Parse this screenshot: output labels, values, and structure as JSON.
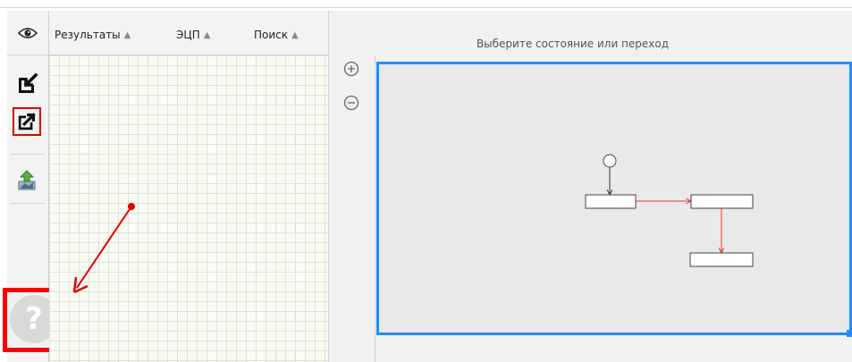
{
  "tabs": [
    {
      "label": "Результаты",
      "icon": "chevron-up-icon"
    },
    {
      "label": "ЭЦП",
      "icon": "chevron-up-icon"
    },
    {
      "label": "Поиск",
      "icon": "chevron-up-icon"
    }
  ],
  "toolbar": {
    "items": [
      "eye-icon",
      "import-icon",
      "export-icon",
      "upload-icon"
    ],
    "help_label": "?"
  },
  "diagram": {
    "prompt": "Выберите состояние или переход",
    "zoom_in": "⊕",
    "zoom_out": "⊖"
  },
  "colors": {
    "accent": "#1e8fff",
    "annotation": "#ff0000",
    "transition": "#e53935"
  }
}
